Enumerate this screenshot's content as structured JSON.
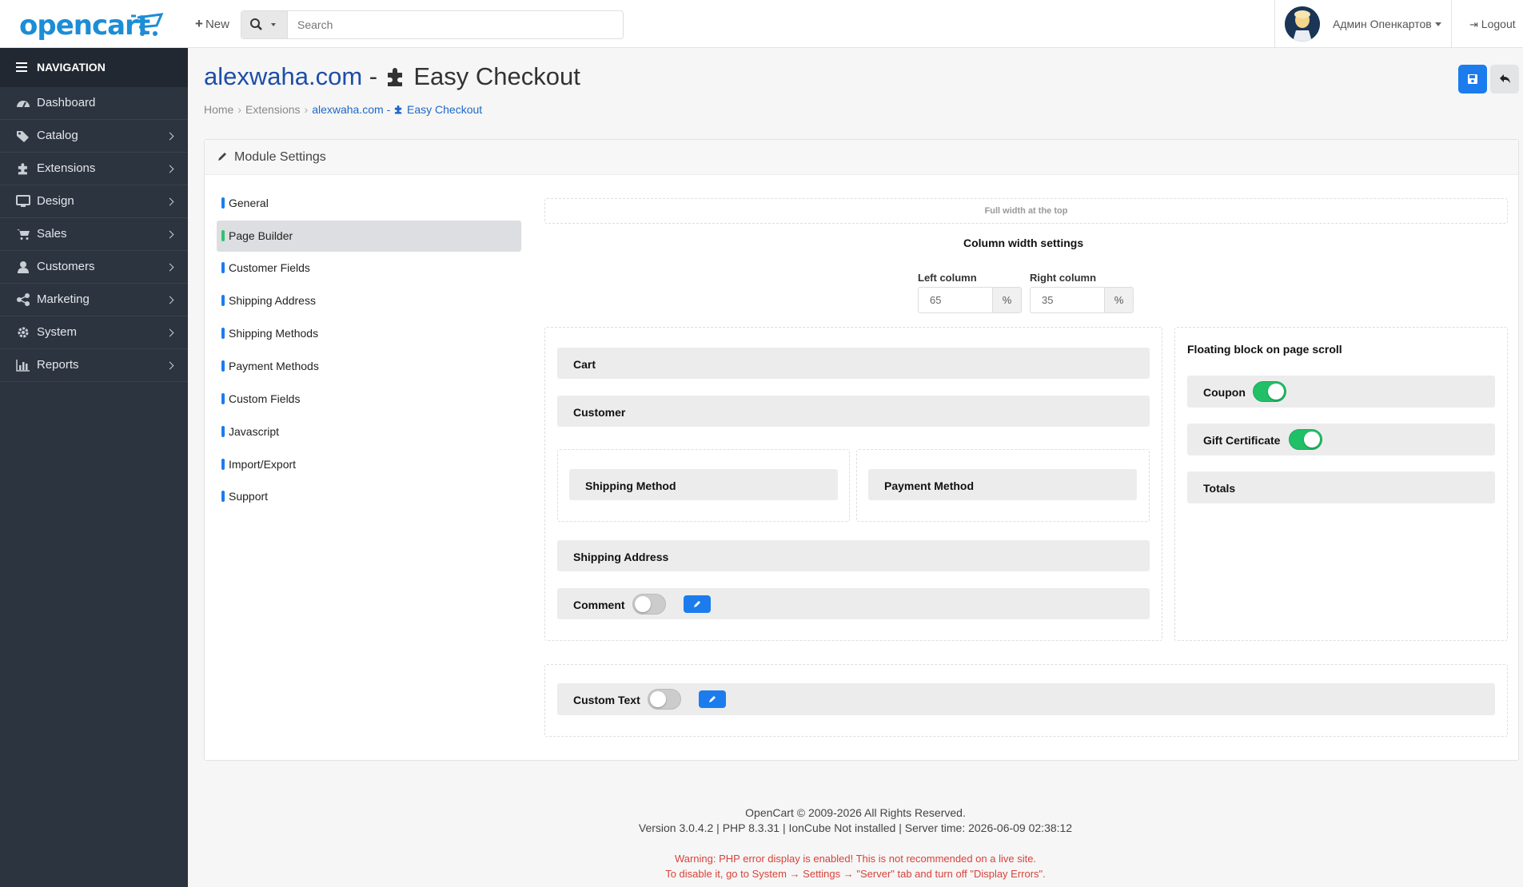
{
  "header": {
    "logo": "opencart",
    "new_label": "New",
    "search_placeholder": "Search",
    "user_name": "Админ Опенкартов",
    "logout_label": "Logout"
  },
  "sidebar": {
    "title": "NAVIGATION",
    "items": [
      {
        "label": "Dashboard",
        "icon": "dashboard-icon",
        "has_children": false
      },
      {
        "label": "Catalog",
        "icon": "tags-icon",
        "has_children": true
      },
      {
        "label": "Extensions",
        "icon": "puzzle-icon",
        "has_children": true
      },
      {
        "label": "Design",
        "icon": "monitor-icon",
        "has_children": true
      },
      {
        "label": "Sales",
        "icon": "cart-icon",
        "has_children": true
      },
      {
        "label": "Customers",
        "icon": "user-icon",
        "has_children": true
      },
      {
        "label": "Marketing",
        "icon": "share-icon",
        "has_children": true
      },
      {
        "label": "System",
        "icon": "gear-icon",
        "has_children": true
      },
      {
        "label": "Reports",
        "icon": "bar-chart-icon",
        "has_children": true
      }
    ]
  },
  "page": {
    "title_brand": "alexwaha.com",
    "title_sep": " - ",
    "title_name": "Easy Checkout",
    "breadcrumb": [
      "Home",
      "Extensions",
      "alexwaha.com - ",
      "Easy Checkout"
    ]
  },
  "panel": {
    "title": "Module Settings",
    "tabs": [
      {
        "label": "General",
        "active": false
      },
      {
        "label": "Page Builder",
        "active": true
      },
      {
        "label": "Customer Fields",
        "active": false
      },
      {
        "label": "Shipping Address",
        "active": false
      },
      {
        "label": "Shipping Methods",
        "active": false
      },
      {
        "label": "Payment Methods",
        "active": false
      },
      {
        "label": "Custom Fields",
        "active": false
      },
      {
        "label": "Javascript",
        "active": false
      },
      {
        "label": "Import/Export",
        "active": false
      },
      {
        "label": "Support",
        "active": false
      }
    ]
  },
  "builder": {
    "full_width_top": "Full width at the top",
    "column_settings_title": "Column width settings",
    "left_column_label": "Left column",
    "left_column_value": "65",
    "right_column_label": "Right column",
    "right_column_value": "35",
    "percent": "%",
    "left_blocks": {
      "cart": "Cart",
      "customer": "Customer",
      "shipping_method": "Shipping Method",
      "payment_method": "Payment Method",
      "shipping_address": "Shipping Address",
      "comment": "Comment",
      "comment_enabled": false
    },
    "right_title": "Floating block on page scroll",
    "right_blocks": {
      "coupon": "Coupon",
      "coupon_enabled": true,
      "gift": "Gift Certificate",
      "gift_enabled": true,
      "totals": "Totals"
    },
    "bottom": {
      "custom_text": "Custom Text",
      "custom_text_enabled": false
    }
  },
  "footer": {
    "copyright": "OpenCart © 2009-2026 All Rights Reserved.",
    "version": "Version 3.0.4.2 | PHP 8.3.31 | IonCube Not installed | Server time: 2026-06-09 02:38:12",
    "warning1": "Warning: PHP error display is enabled! This is not recommended on a live site.",
    "warning2": "To disable it, go to System → Settings → \"Server\" tab and turn off \"Display Errors\"."
  },
  "colors": {
    "accent": "#1c7ced",
    "success": "#20c067",
    "sidebar": "#2c3440",
    "warning": "#d9433a"
  }
}
